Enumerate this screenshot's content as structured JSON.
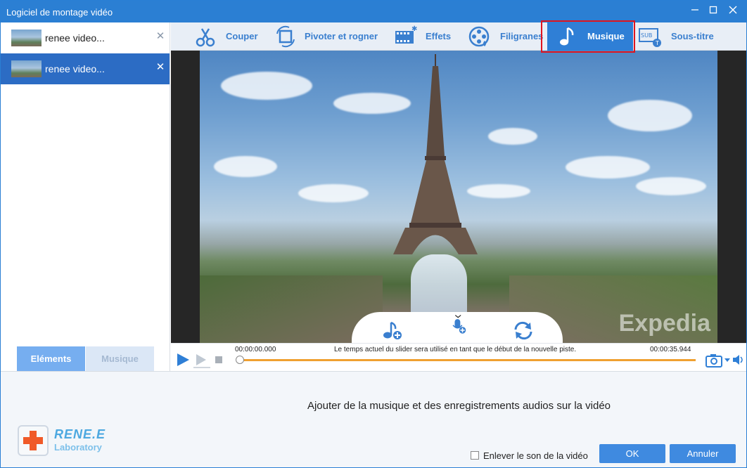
{
  "window": {
    "title": "Logiciel de montage vidéo"
  },
  "files": [
    {
      "name": "renee video...",
      "selected": false
    },
    {
      "name": "renee video...",
      "selected": true
    }
  ],
  "left_tabs": {
    "elements": "Eléments",
    "music": "Musique"
  },
  "toolbar": {
    "cut": "Couper",
    "rotate": "Pivoter et rogner",
    "effects": "Effets",
    "watermarks": "Filigranes",
    "music": "Musique",
    "subtitle": "Sous-titre"
  },
  "video": {
    "watermark": "Expedia"
  },
  "timeline": {
    "start": "00:00:00.000",
    "end": "00:00:35.944",
    "message": "Le temps actuel du slider sera utilisé en tant que le début de la nouvelle piste."
  },
  "bottom": {
    "info": "Ajouter de la musique et des enregistrements audios sur la vidéo",
    "mute_label": "Enlever le son de la vidéo",
    "ok": "OK",
    "cancel": "Annuler"
  },
  "logo": {
    "brand": "RENE.E",
    "sub": "Laboratory"
  },
  "colors": {
    "accent": "#2b7fd3",
    "highlight_box": "#e0141e",
    "track": "#f0a030"
  }
}
